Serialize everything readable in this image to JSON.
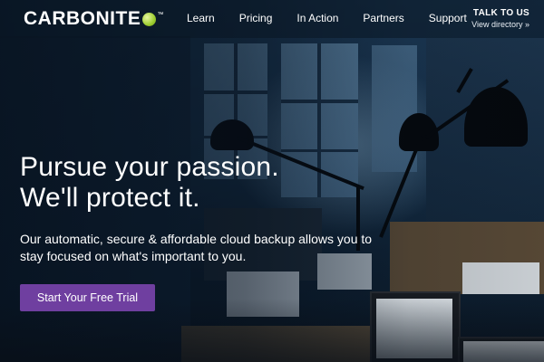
{
  "header": {
    "logo_text": "CARBONITE",
    "logo_tm": "™",
    "nav": [
      "Learn",
      "Pricing",
      "In Action",
      "Partners",
      "Support"
    ],
    "talk_title": "TALK TO US",
    "talk_link": "View directory »"
  },
  "hero": {
    "headline_line1": "Pursue your passion.",
    "headline_line2": "We'll protect it.",
    "subtext": "Our automatic, secure & affordable cloud backup allows you to stay focused on what's important to you.",
    "cta_label": "Start Your Free Trial"
  },
  "colors": {
    "cta": "#6f3fa0",
    "logo_dot": "#9ccc2f",
    "header_bg": "#0a1622"
  }
}
